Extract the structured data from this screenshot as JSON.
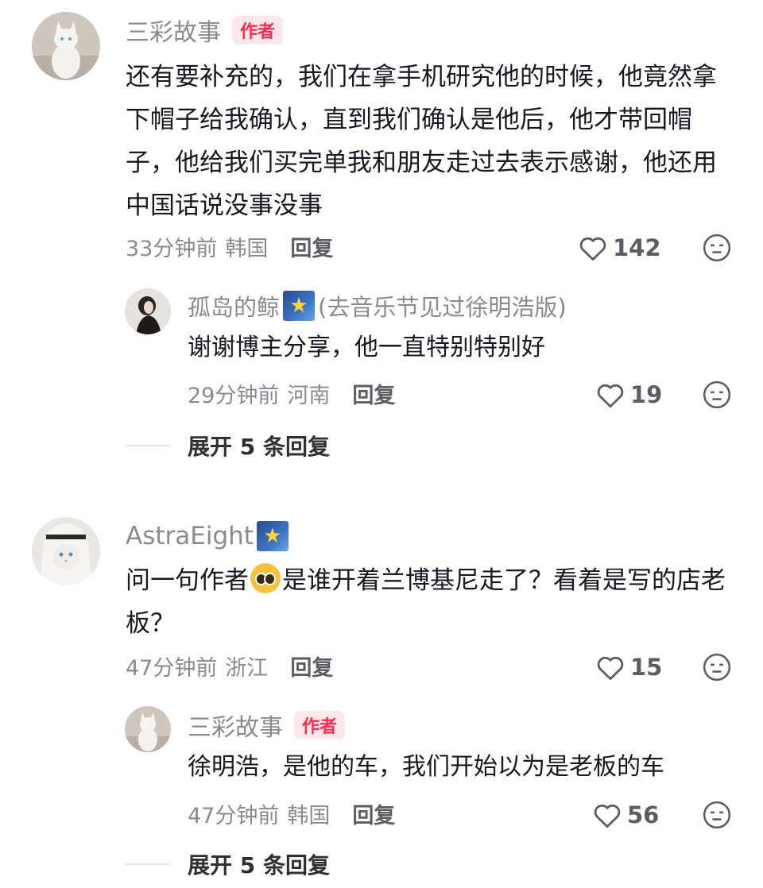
{
  "comments": [
    {
      "username": "三彩故事",
      "badge": "作者",
      "text": "还有要补充的，我们在拿手机研究他的时候，他竟然拿下帽子给我确认，直到我们确认是他后，他才带回帽子，他给我们买完单我和朋友走过去表示感谢，他还用中国话说没事没事",
      "time": "33分钟前",
      "location": "韩国",
      "reply_label": "回复",
      "likes": "142",
      "replies": [
        {
          "username": "孤岛的鲸",
          "star_badge": "star-badge-icon",
          "tag": "(去音乐节见过徐明浩版)",
          "text": "谢谢博主分享，他一直特别特别好",
          "time": "29分钟前",
          "location": "河南",
          "reply_label": "回复",
          "likes": "19"
        }
      ],
      "expand_label": "展开 5 条回复"
    },
    {
      "username": "AstraEight",
      "star_badge": "star-badge-icon",
      "text_before": "问一句作者",
      "emoji": "pleading-face-emoji",
      "text_after": "是谁开着兰博基尼走了？看着是写的店老板？",
      "time": "47分钟前",
      "location": "浙江",
      "reply_label": "回复",
      "likes": "15",
      "replies": [
        {
          "username": "三彩故事",
          "badge": "作者",
          "text": "徐明浩，是他的车，我们开始以为是老板的车",
          "time": "47分钟前",
          "location": "韩国",
          "reply_label": "回复",
          "likes": "56"
        }
      ],
      "expand_label": "展开 5 条回复"
    }
  ],
  "colors": {
    "author_badge_bg": "#fde8ea",
    "author_badge_text": "#fe2c55",
    "username": "#8a8b91",
    "body_text": "#161823"
  }
}
